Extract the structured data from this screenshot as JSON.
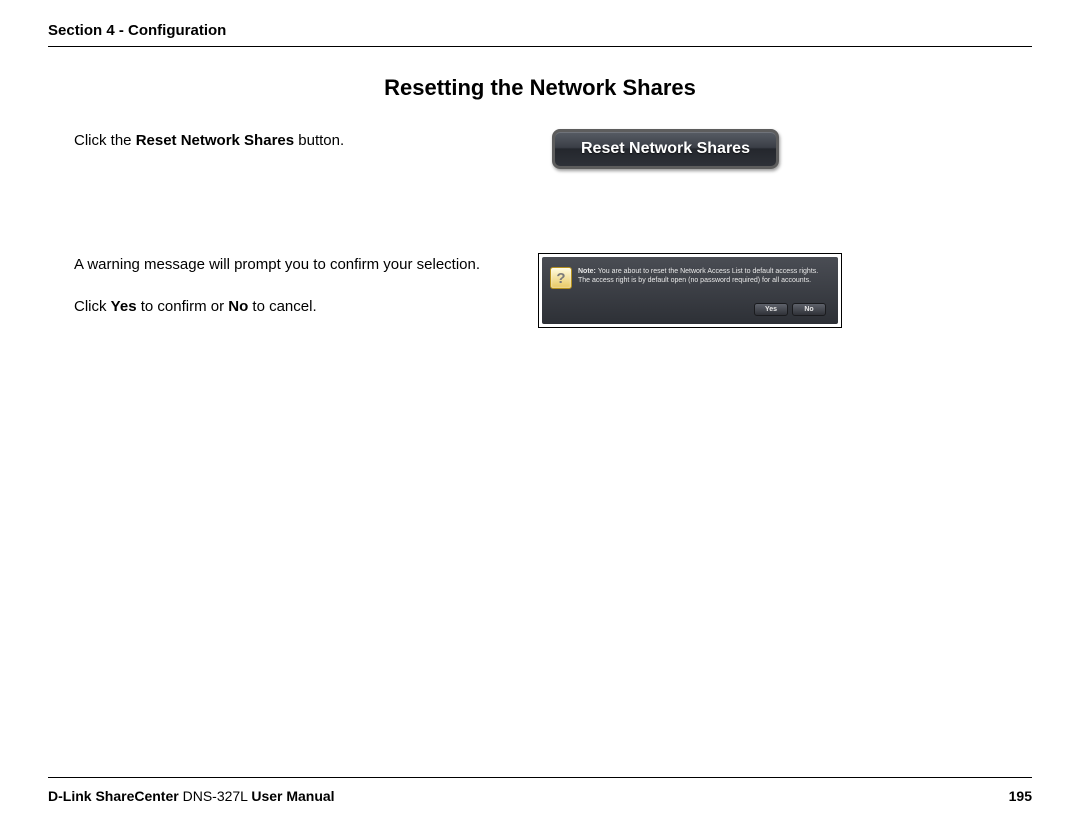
{
  "header": {
    "section": "Section 4 - Configuration"
  },
  "title": "Resetting the Network Shares",
  "step1": {
    "pre": "Click the ",
    "bold": "Reset Network Shares",
    "post": " button.",
    "button_label": "Reset Network Shares"
  },
  "step2": {
    "line1": "A warning message will prompt you to confirm your selection.",
    "line2_pre": "Click ",
    "line2_b1": "Yes",
    "line2_mid": " to confirm or ",
    "line2_b2": "No",
    "line2_post": " to cancel."
  },
  "dialog": {
    "icon_glyph": "?",
    "note_prefix": "Note: ",
    "note_line1": "You are about to reset the Network Access List to default access rights.",
    "note_line2": "The access right is by default open (no password required) for all accounts.",
    "yes": "Yes",
    "no": "No"
  },
  "footer": {
    "brand_bold1": "D-Link ShareCenter",
    "model": " DNS-327L ",
    "brand_bold2": "User Manual",
    "page": "195"
  }
}
